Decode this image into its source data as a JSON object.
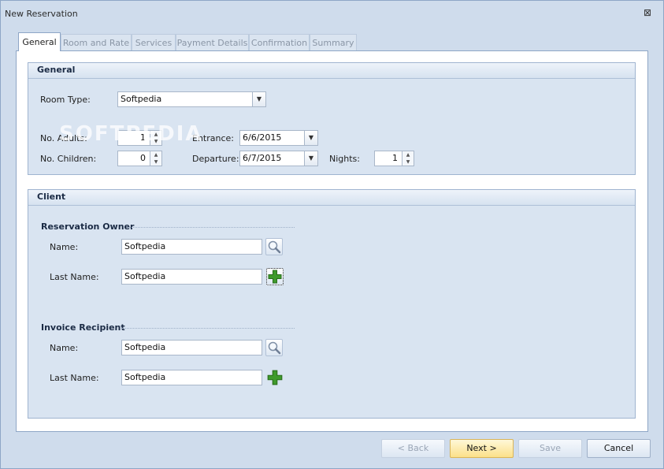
{
  "window": {
    "title": "New Reservation",
    "close_glyph": "⊠"
  },
  "tabs": [
    {
      "label": "General",
      "active": true
    },
    {
      "label": "Room and Rate",
      "active": false
    },
    {
      "label": "Services",
      "active": false
    },
    {
      "label": "Payment Details",
      "active": false
    },
    {
      "label": "Confirmation",
      "active": false
    },
    {
      "label": "Summary",
      "active": false
    }
  ],
  "general": {
    "title": "General",
    "room_type_label": "Room Type:",
    "room_type_value": "Softpedia",
    "adults_label": "No. Adults:",
    "adults_value": "1",
    "children_label": "No. Children:",
    "children_value": "0",
    "entrance_label": "Entrance:",
    "entrance_value": "6/6/2015",
    "departure_label": "Departure:",
    "departure_value": "6/7/2015",
    "nights_label": "Nights:",
    "nights_value": "1"
  },
  "client": {
    "title": "Client",
    "owner": {
      "section_label": "Reservation Owner",
      "name_label": "Name:",
      "name_value": "Softpedia",
      "lastname_label": "Last Name:",
      "lastname_value": "Softpedia"
    },
    "invoice": {
      "section_label": "Invoice Recipient",
      "name_label": "Name:",
      "name_value": "Softpedia",
      "lastname_label": "Last Name:",
      "lastname_value": "Softpedia"
    }
  },
  "buttons": {
    "back": "< Back",
    "next": "Next >",
    "save": "Save",
    "cancel": "Cancel"
  },
  "watermark": "SOFTPEDIA",
  "icons": {
    "search": "magnifier-icon",
    "add": "green-plus-icon",
    "dropdown": "chevron-down-icon"
  },
  "colors": {
    "accent_next": "#fbe089",
    "plus_green": "#3f9a2c",
    "panel": "#d9e4f1"
  }
}
